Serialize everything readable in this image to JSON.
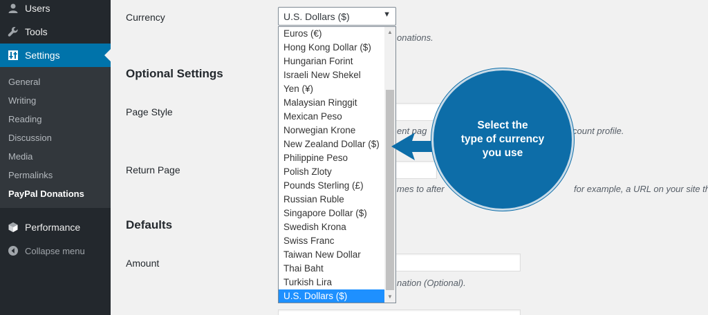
{
  "sidebar": {
    "top_items": [
      {
        "label": "Users",
        "icon": "users-icon"
      },
      {
        "label": "Tools",
        "icon": "wrench-icon"
      },
      {
        "label": "Settings",
        "icon": "settings-icon",
        "current": true
      }
    ],
    "settings_submenu": [
      "General",
      "Writing",
      "Reading",
      "Discussion",
      "Media",
      "Permalinks",
      "PayPal Donations"
    ],
    "current_submenu": "PayPal Donations",
    "bottom_items": [
      {
        "label": "Performance",
        "icon": "performance-icon"
      },
      {
        "label": "Collapse menu",
        "icon": "collapse-icon"
      }
    ]
  },
  "form": {
    "currency_label": "Currency",
    "currency_value": "U.S. Dollars ($)",
    "currency_desc": "onations.",
    "optional_settings_title": "Optional Settings",
    "page_style_label": "Page Style",
    "page_style_desc_left": "ent pag",
    "page_style_desc_right": "count profile.",
    "return_page_label": "Return Page",
    "return_page_desc_left": "mes to after",
    "return_page_desc_right": "for example, a URL on your site that",
    "defaults_title": "Defaults",
    "amount_label": "Amount",
    "amount_desc": "nation (Optional)."
  },
  "dropdown": {
    "options": [
      "Euros (€)",
      "Hong Kong Dollar ($)",
      "Hungarian Forint",
      "Israeli New Shekel",
      "Yen (¥)",
      "Malaysian Ringgit",
      "Mexican Peso",
      "Norwegian Krone",
      "New Zealand Dollar ($)",
      "Philippine Peso",
      "Polish Zloty",
      "Pounds Sterling (£)",
      "Russian Ruble",
      "Singapore Dollar ($)",
      "Swedish Krona",
      "Swiss Franc",
      "Taiwan New Dollar",
      "Thai Baht",
      "Turkish Lira",
      "U.S. Dollars ($)"
    ],
    "selected": "U.S. Dollars ($)"
  },
  "callout": {
    "lines": [
      "Select the",
      "type of currency",
      "you use"
    ]
  },
  "colors": {
    "sidebar_bg": "#23282d",
    "submenu_bg": "#32373c",
    "accent": "#0073aa",
    "callout": "#0d6da8",
    "option_highlight": "#1e90ff"
  }
}
